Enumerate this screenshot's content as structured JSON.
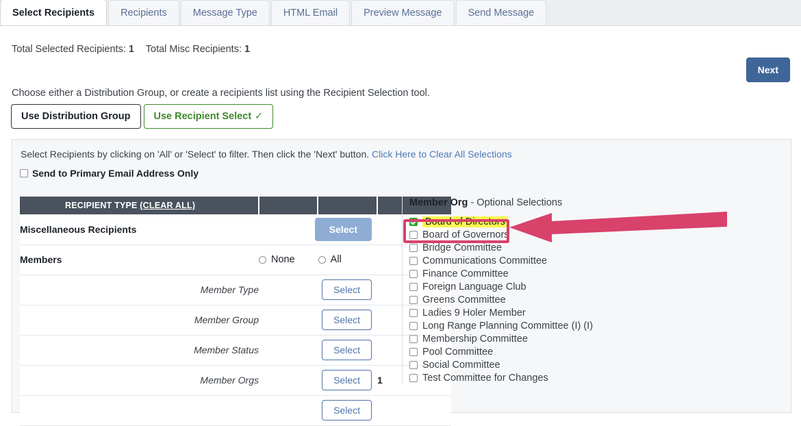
{
  "tabs": [
    {
      "label": "Select Recipients",
      "active": true
    },
    {
      "label": "Recipients",
      "active": false
    },
    {
      "label": "Message Type",
      "active": false
    },
    {
      "label": "HTML Email",
      "active": false
    },
    {
      "label": "Preview Message",
      "active": false
    },
    {
      "label": "Send Message",
      "active": false
    }
  ],
  "totals": {
    "selected_label": "Total Selected Recipients:",
    "selected_value": "1",
    "misc_label": "Total Misc Recipients:",
    "misc_value": "1"
  },
  "next_button": "Next",
  "choose_line": "Choose either a Distribution Group, or create a recipients list using the Recipient Selection tool.",
  "mode_buttons": {
    "distribution_group": "Use Distribution Group",
    "recipient_select": "Use Recipient Select",
    "recipient_select_check": "✓"
  },
  "panel": {
    "instruction": "Select Recipients by clicking on 'All' or 'Select' to filter. Then click the 'Next' button.",
    "clear_all_link": "Click Here to Clear All Selections",
    "primary_only_label": "Send to Primary Email Address Only"
  },
  "table": {
    "header": {
      "col1": "RECIPIENT TYPE",
      "col1_clear": "(CLEAR ALL)",
      "col2": "",
      "col3": "",
      "col4": ""
    },
    "rows": [
      {
        "label": "Miscellaneous Recipients",
        "style": "bold",
        "button": "Select",
        "button_style": "filled",
        "count": ""
      },
      {
        "label": "Members",
        "style": "bold",
        "button": "",
        "button_style": "radios",
        "none_label": "None",
        "all_label": "All",
        "count": ""
      },
      {
        "label": "Member Type",
        "style": "italic",
        "button": "Select",
        "button_style": "outline",
        "count": ""
      },
      {
        "label": "Member Group",
        "style": "italic",
        "button": "Select",
        "button_style": "outline",
        "count": ""
      },
      {
        "label": "Member Status",
        "style": "italic",
        "button": "Select",
        "button_style": "outline",
        "count": ""
      },
      {
        "label": "Member Orgs",
        "style": "italic",
        "button": "Select",
        "button_style": "outline",
        "count": "1"
      },
      {
        "label": "",
        "style": "italic",
        "button": "Select",
        "button_style": "outline",
        "count": ""
      }
    ]
  },
  "right_panel": {
    "title_bold": "Member Org",
    "title_rest": " - Optional Selections",
    "options": [
      {
        "label": "Board of Directors",
        "checked": true
      },
      {
        "label": "Board of Governors",
        "checked": false
      },
      {
        "label": "Bridge Committee",
        "checked": false
      },
      {
        "label": "Communications Committee",
        "checked": false
      },
      {
        "label": "Finance Committee",
        "checked": false
      },
      {
        "label": "Foreign Language Club",
        "checked": false
      },
      {
        "label": "Greens Committee",
        "checked": false
      },
      {
        "label": "Ladies 9 Holer Member",
        "checked": false
      },
      {
        "label": "Long Range Planning Committee (I) (I)",
        "checked": false
      },
      {
        "label": "Membership Committee",
        "checked": false
      },
      {
        "label": "Pool Committee",
        "checked": false
      },
      {
        "label": "Social Committee",
        "checked": false
      },
      {
        "label": "Test Committee for Changes",
        "checked": false
      }
    ]
  },
  "colors": {
    "annotation": "#d8426b",
    "highlight": "#faf750",
    "checkbox_checked": "#2fa82f",
    "next_button": "#3f6699",
    "table_header": "#4a525d",
    "green_accent": "#3e8a2e",
    "link": "#4e7ab5"
  }
}
